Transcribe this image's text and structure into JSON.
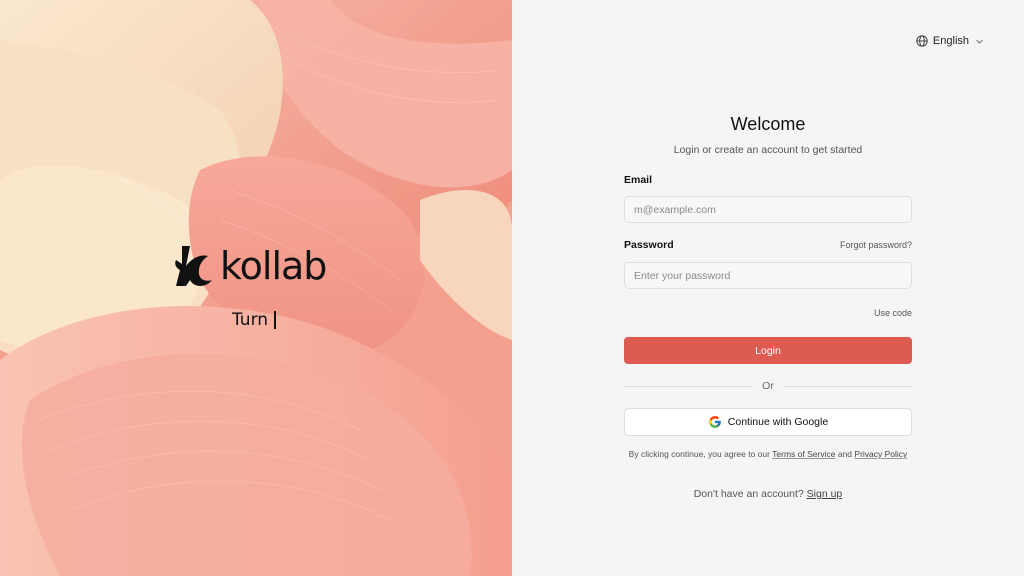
{
  "brand": {
    "name": "kollab",
    "typing_text": "Turn"
  },
  "language": {
    "label": "English"
  },
  "form": {
    "title": "Welcome",
    "subtitle": "Login or create an account to get started",
    "email_label": "Email",
    "email_placeholder": "m@example.com",
    "email_value": "",
    "password_label": "Password",
    "forgot_password": "Forgot password?",
    "password_placeholder": "Enter your password",
    "password_value": "",
    "use_code": "Use code",
    "login_button": "Login",
    "divider_text": "Or",
    "google_button": "Continue with Google",
    "terms_prefix": "By clicking continue, you agree to our",
    "terms_link": "Terms of Service",
    "terms_and": "and",
    "privacy_link": "Privacy Policy",
    "signup_prompt": "Don't have an account?",
    "signup_link": "Sign up"
  },
  "colors": {
    "primary": "#de5b52",
    "panel_bg": "#f5f5f5",
    "petal_peach": "#f4a592",
    "petal_cream": "#f7dcc0"
  },
  "icons": {
    "language": "globe-icon",
    "language_dropdown": "chevron-down-icon",
    "google": "google-icon"
  }
}
